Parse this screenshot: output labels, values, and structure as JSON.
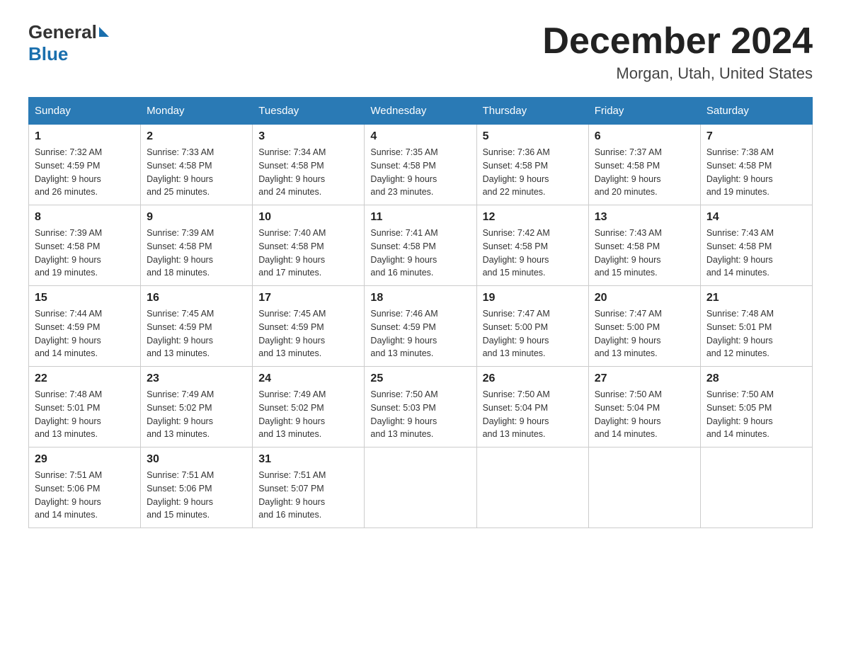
{
  "header": {
    "logo_general": "General",
    "logo_blue": "Blue",
    "title": "December 2024",
    "subtitle": "Morgan, Utah, United States"
  },
  "days_of_week": [
    "Sunday",
    "Monday",
    "Tuesday",
    "Wednesday",
    "Thursday",
    "Friday",
    "Saturday"
  ],
  "weeks": [
    [
      {
        "day": "1",
        "sunrise": "7:32 AM",
        "sunset": "4:59 PM",
        "daylight": "9 hours and 26 minutes."
      },
      {
        "day": "2",
        "sunrise": "7:33 AM",
        "sunset": "4:58 PM",
        "daylight": "9 hours and 25 minutes."
      },
      {
        "day": "3",
        "sunrise": "7:34 AM",
        "sunset": "4:58 PM",
        "daylight": "9 hours and 24 minutes."
      },
      {
        "day": "4",
        "sunrise": "7:35 AM",
        "sunset": "4:58 PM",
        "daylight": "9 hours and 23 minutes."
      },
      {
        "day": "5",
        "sunrise": "7:36 AM",
        "sunset": "4:58 PM",
        "daylight": "9 hours and 22 minutes."
      },
      {
        "day": "6",
        "sunrise": "7:37 AM",
        "sunset": "4:58 PM",
        "daylight": "9 hours and 20 minutes."
      },
      {
        "day": "7",
        "sunrise": "7:38 AM",
        "sunset": "4:58 PM",
        "daylight": "9 hours and 19 minutes."
      }
    ],
    [
      {
        "day": "8",
        "sunrise": "7:39 AM",
        "sunset": "4:58 PM",
        "daylight": "9 hours and 19 minutes."
      },
      {
        "day": "9",
        "sunrise": "7:39 AM",
        "sunset": "4:58 PM",
        "daylight": "9 hours and 18 minutes."
      },
      {
        "day": "10",
        "sunrise": "7:40 AM",
        "sunset": "4:58 PM",
        "daylight": "9 hours and 17 minutes."
      },
      {
        "day": "11",
        "sunrise": "7:41 AM",
        "sunset": "4:58 PM",
        "daylight": "9 hours and 16 minutes."
      },
      {
        "day": "12",
        "sunrise": "7:42 AM",
        "sunset": "4:58 PM",
        "daylight": "9 hours and 15 minutes."
      },
      {
        "day": "13",
        "sunrise": "7:43 AM",
        "sunset": "4:58 PM",
        "daylight": "9 hours and 15 minutes."
      },
      {
        "day": "14",
        "sunrise": "7:43 AM",
        "sunset": "4:58 PM",
        "daylight": "9 hours and 14 minutes."
      }
    ],
    [
      {
        "day": "15",
        "sunrise": "7:44 AM",
        "sunset": "4:59 PM",
        "daylight": "9 hours and 14 minutes."
      },
      {
        "day": "16",
        "sunrise": "7:45 AM",
        "sunset": "4:59 PM",
        "daylight": "9 hours and 13 minutes."
      },
      {
        "day": "17",
        "sunrise": "7:45 AM",
        "sunset": "4:59 PM",
        "daylight": "9 hours and 13 minutes."
      },
      {
        "day": "18",
        "sunrise": "7:46 AM",
        "sunset": "4:59 PM",
        "daylight": "9 hours and 13 minutes."
      },
      {
        "day": "19",
        "sunrise": "7:47 AM",
        "sunset": "5:00 PM",
        "daylight": "9 hours and 13 minutes."
      },
      {
        "day": "20",
        "sunrise": "7:47 AM",
        "sunset": "5:00 PM",
        "daylight": "9 hours and 13 minutes."
      },
      {
        "day": "21",
        "sunrise": "7:48 AM",
        "sunset": "5:01 PM",
        "daylight": "9 hours and 12 minutes."
      }
    ],
    [
      {
        "day": "22",
        "sunrise": "7:48 AM",
        "sunset": "5:01 PM",
        "daylight": "9 hours and 13 minutes."
      },
      {
        "day": "23",
        "sunrise": "7:49 AM",
        "sunset": "5:02 PM",
        "daylight": "9 hours and 13 minutes."
      },
      {
        "day": "24",
        "sunrise": "7:49 AM",
        "sunset": "5:02 PM",
        "daylight": "9 hours and 13 minutes."
      },
      {
        "day": "25",
        "sunrise": "7:50 AM",
        "sunset": "5:03 PM",
        "daylight": "9 hours and 13 minutes."
      },
      {
        "day": "26",
        "sunrise": "7:50 AM",
        "sunset": "5:04 PM",
        "daylight": "9 hours and 13 minutes."
      },
      {
        "day": "27",
        "sunrise": "7:50 AM",
        "sunset": "5:04 PM",
        "daylight": "9 hours and 14 minutes."
      },
      {
        "day": "28",
        "sunrise": "7:50 AM",
        "sunset": "5:05 PM",
        "daylight": "9 hours and 14 minutes."
      }
    ],
    [
      {
        "day": "29",
        "sunrise": "7:51 AM",
        "sunset": "5:06 PM",
        "daylight": "9 hours and 14 minutes."
      },
      {
        "day": "30",
        "sunrise": "7:51 AM",
        "sunset": "5:06 PM",
        "daylight": "9 hours and 15 minutes."
      },
      {
        "day": "31",
        "sunrise": "7:51 AM",
        "sunset": "5:07 PM",
        "daylight": "9 hours and 16 minutes."
      },
      null,
      null,
      null,
      null
    ]
  ],
  "labels": {
    "sunrise": "Sunrise:",
    "sunset": "Sunset:",
    "daylight": "Daylight:"
  }
}
